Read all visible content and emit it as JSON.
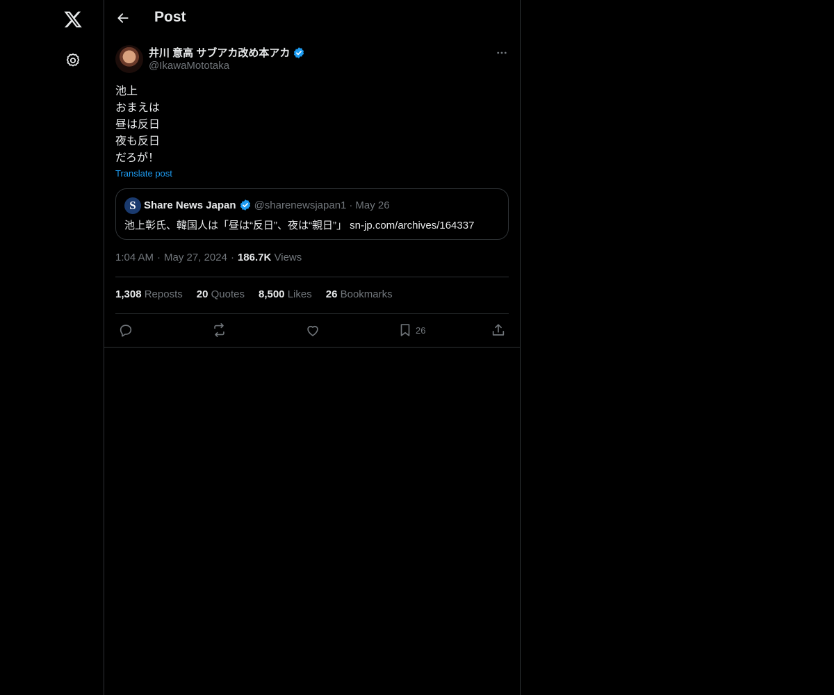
{
  "header": {
    "title": "Post"
  },
  "author": {
    "display_name": "井川 意高 サブアカ改め本アカ",
    "handle": "@IkawaMototaka",
    "verified": true
  },
  "post": {
    "lines": [
      "池上",
      "おまえは",
      "昼は反日",
      "夜も反日",
      "だろが！"
    ],
    "translate_label": "Translate post"
  },
  "quote": {
    "avatar_letter": "S",
    "name": "Share News Japan",
    "handle": "@sharenewsjapan1",
    "separator": "·",
    "date": "May 26",
    "text": "池上彰氏、韓国人は「昼は“反日”、夜は“親日”」 sn-jp.com/archives/164337"
  },
  "meta": {
    "time": "1:04 AM",
    "date": "May 27, 2024",
    "separator": "·",
    "views_count": "186.7K",
    "views_label": "Views"
  },
  "stats": {
    "reposts_count": "1,308",
    "reposts_label": "Reposts",
    "quotes_count": "20",
    "quotes_label": "Quotes",
    "likes_count": "8,500",
    "likes_label": "Likes",
    "bookmarks_count": "26",
    "bookmarks_label": "Bookmarks"
  },
  "actions": {
    "bookmark_count": "26"
  },
  "colors": {
    "background": "#000000",
    "border": "#2f3336",
    "text_primary": "#e7e9ea",
    "text_secondary": "#71767b",
    "accent": "#1d9bf0"
  }
}
